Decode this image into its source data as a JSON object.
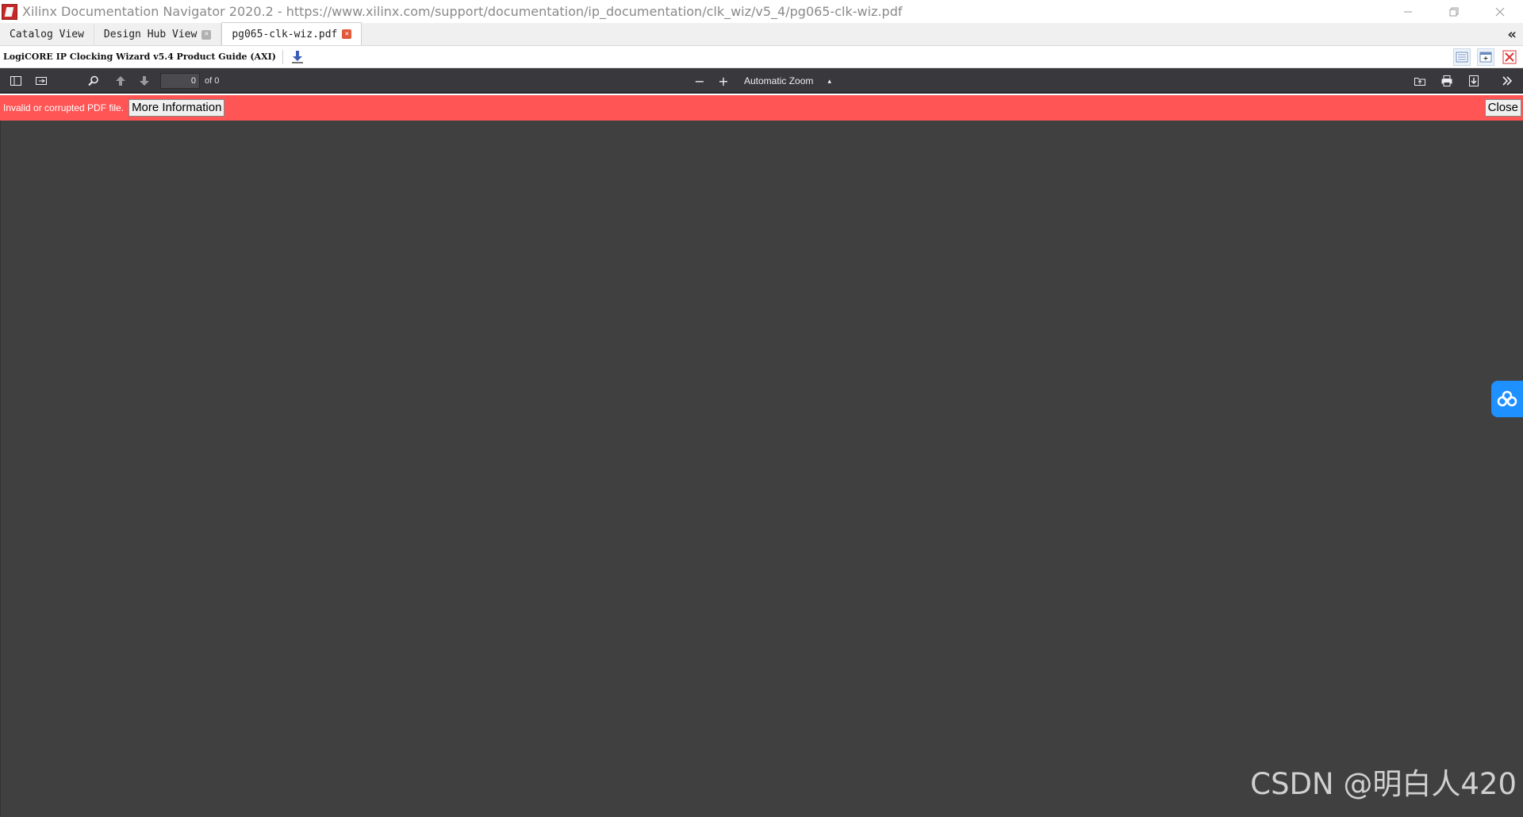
{
  "window": {
    "title": "Xilinx Documentation Navigator 2020.2 -  https://www.xilinx.com/support/documentation/ip_documentation/clk_wiz/v5_4/pg065-clk-wiz.pdf"
  },
  "tabs": [
    {
      "label": "Catalog View",
      "closable": false,
      "active": false
    },
    {
      "label": "Design Hub View",
      "closable": true,
      "active": false
    },
    {
      "label": "pg065-clk-wiz.pdf",
      "closable": true,
      "active": true
    }
  ],
  "document": {
    "title": "LogiCORE IP Clocking Wizard v5.4 Product Guide (AXI)"
  },
  "pdf_toolbar": {
    "page_number": "0",
    "page_count_label": "of 0",
    "zoom_label": "Automatic Zoom",
    "zoom_minus": "−",
    "zoom_plus": "+"
  },
  "error_bar": {
    "message": "Invalid or corrupted PDF file.",
    "more_info_label": "More Information",
    "close_label": "Close"
  },
  "watermark": {
    "text": "CSDN @明白人420"
  },
  "colors": {
    "error_bar": "#ff5555",
    "pdf_toolbar": "#38383d",
    "viewer_bg": "#404040",
    "float_button": "#1e90ff"
  }
}
